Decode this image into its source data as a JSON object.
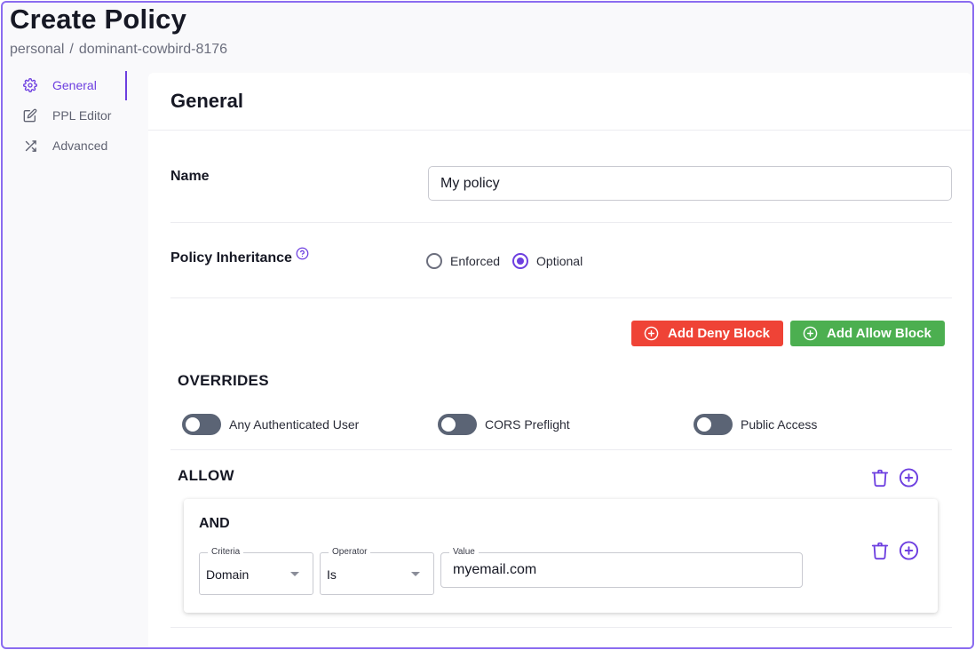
{
  "page": {
    "title": "Create Policy",
    "breadcrumb": [
      "personal",
      "dominant-cowbird-8176"
    ],
    "breadcrumb_separator": "/"
  },
  "sidebar": {
    "items": [
      {
        "label": "General",
        "icon": "gear-icon",
        "active": true
      },
      {
        "label": "PPL Editor",
        "icon": "edit-icon",
        "active": false
      },
      {
        "label": "Advanced",
        "icon": "shuffle-icon",
        "active": false
      }
    ]
  },
  "card": {
    "title": "General",
    "name_label": "Name",
    "name_value": "My policy",
    "inheritance_label": "Policy Inheritance",
    "inheritance_options": [
      {
        "label": "Enforced",
        "selected": false
      },
      {
        "label": "Optional",
        "selected": true
      }
    ],
    "add_deny_label": "Add Deny Block",
    "add_allow_label": "Add Allow Block",
    "overrides": {
      "title": "OVERRIDES",
      "toggles": [
        {
          "label": "Any Authenticated User",
          "on": false
        },
        {
          "label": "CORS Preflight",
          "on": false
        },
        {
          "label": "Public Access",
          "on": false
        }
      ]
    },
    "allow": {
      "title": "ALLOW",
      "and_block": {
        "title": "AND",
        "criteria_label": "Criteria",
        "criteria_value": "Domain",
        "operator_label": "Operator",
        "operator_value": "Is",
        "value_label": "Value",
        "value_value": "myemail.com"
      }
    }
  },
  "colors": {
    "accent": "#6d3fe0",
    "deny": "#ef4336",
    "allow": "#4caf50",
    "toggle_off": "#5b6475"
  }
}
